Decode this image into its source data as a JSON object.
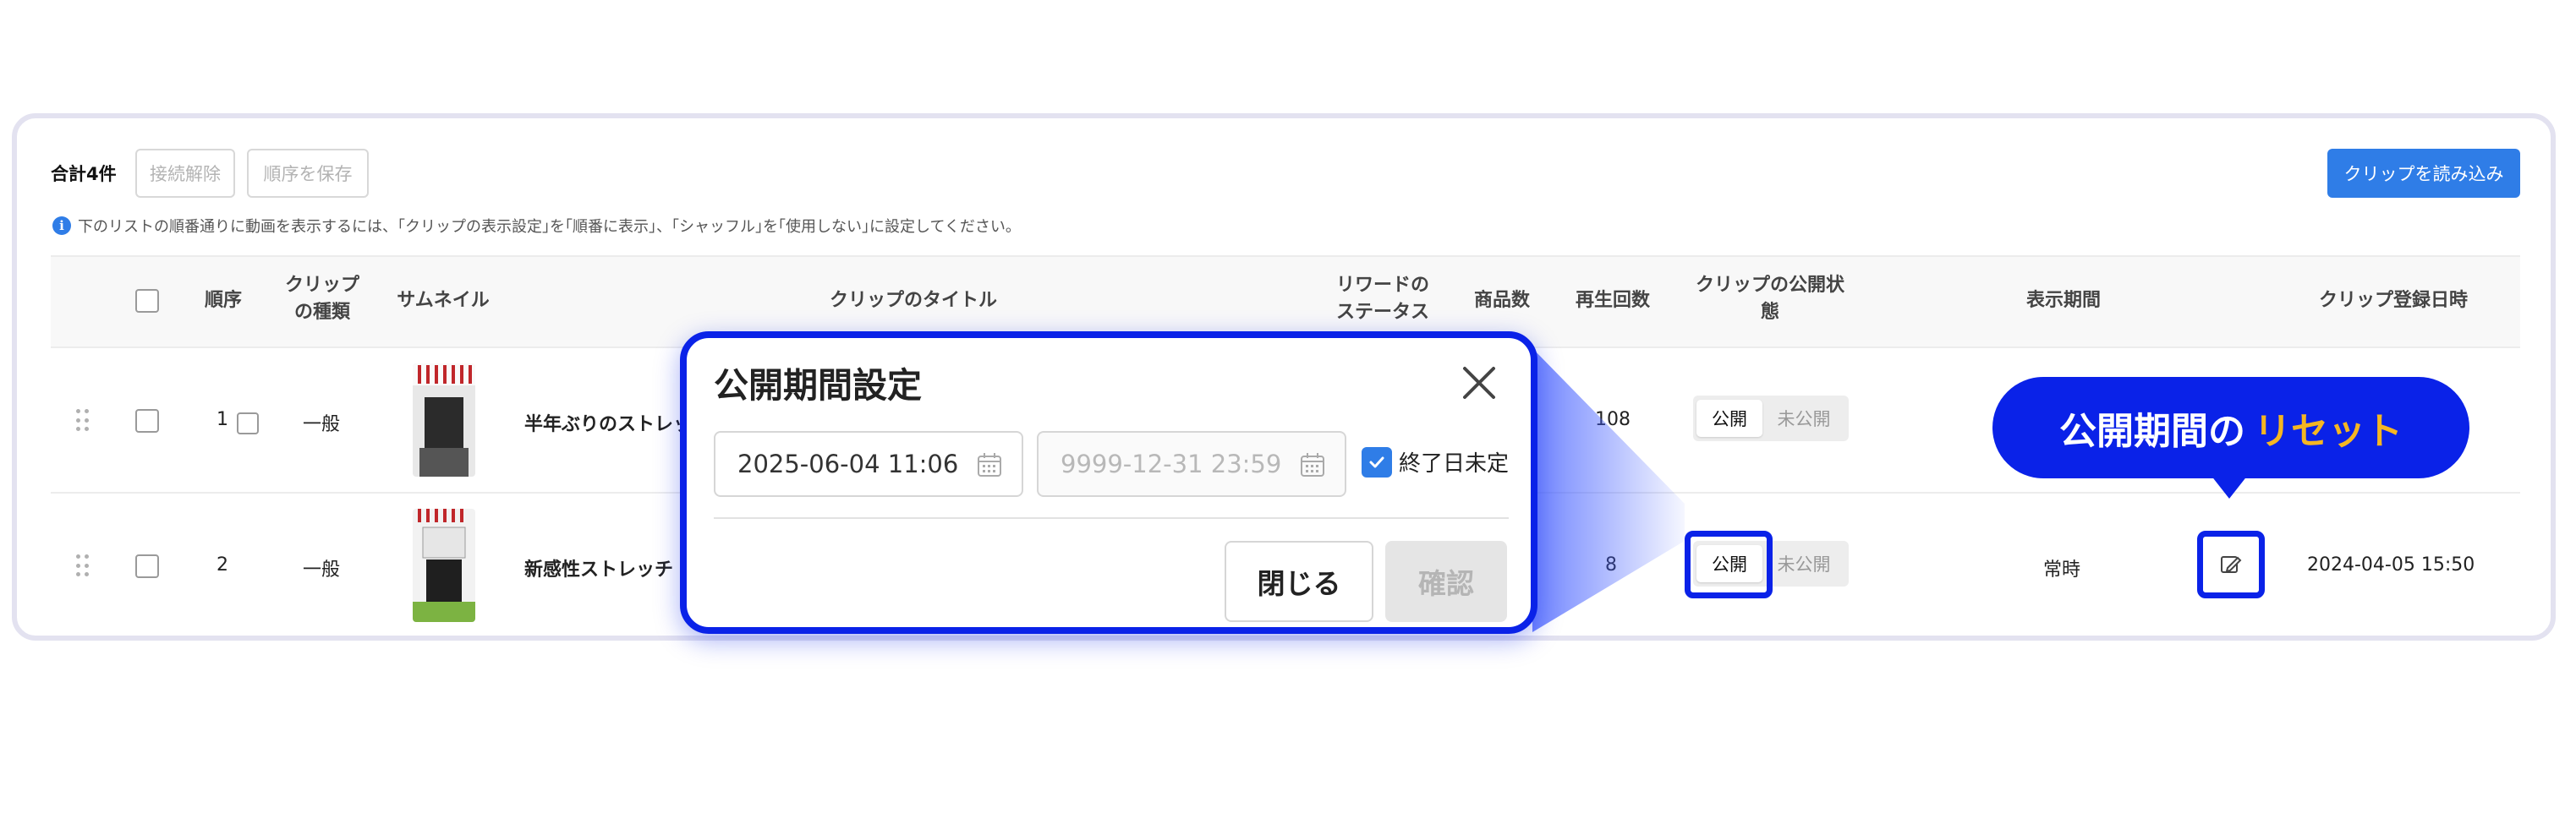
{
  "toolbar": {
    "total": "合計4件",
    "disconnect": "接続解除",
    "save_order": "順序を保存",
    "import_clips": "クリップを読み込み",
    "info": "下のリストの順番通りに動画を表示するには、｢クリップの表示設定｣を｢順番に表示｣、｢シャッフル｣を｢使用しない｣に設定してください。"
  },
  "headers": {
    "order": "順序",
    "type_1": "クリップ",
    "type_2": "の種類",
    "thumbnail": "サムネイル",
    "title": "クリップのタイトル",
    "reward_1": "リワードの",
    "reward_2": "ステータス",
    "products": "商品数",
    "plays": "再生回数",
    "visibility_1": "クリップの公開状",
    "visibility_2": "態",
    "period": "表示期間",
    "registered": "クリップ登録日時"
  },
  "rows": [
    {
      "order": "1",
      "type": "一般",
      "title": "半年ぶりのストレッ",
      "plays": "108",
      "on": "公開",
      "off": "未公開",
      "period": "",
      "registered": ""
    },
    {
      "order": "2",
      "type": "一般",
      "title": "新感性ストレッチ",
      "plays": "8",
      "on": "公開",
      "off": "未公開",
      "period": "常時",
      "registered": "2024-04-05 15:50"
    }
  ],
  "modal": {
    "title": "公開期間設定",
    "start": "2025-06-04 11:06",
    "end_placeholder": "9999-12-31 23:59",
    "end_undetermined": "終了日未定",
    "close": "閉じる",
    "confirm": "確認"
  },
  "callout": {
    "text_white": "公開期間の",
    "text_yellow": "リセット"
  },
  "colors": {
    "primary": "#2f7de7",
    "highlight": "#0a22e8",
    "callout_accent": "#f5b622"
  },
  "icons": [
    "info-icon",
    "drag-handle-icon",
    "calendar-icon",
    "close-icon",
    "check-icon",
    "edit-period-icon"
  ]
}
